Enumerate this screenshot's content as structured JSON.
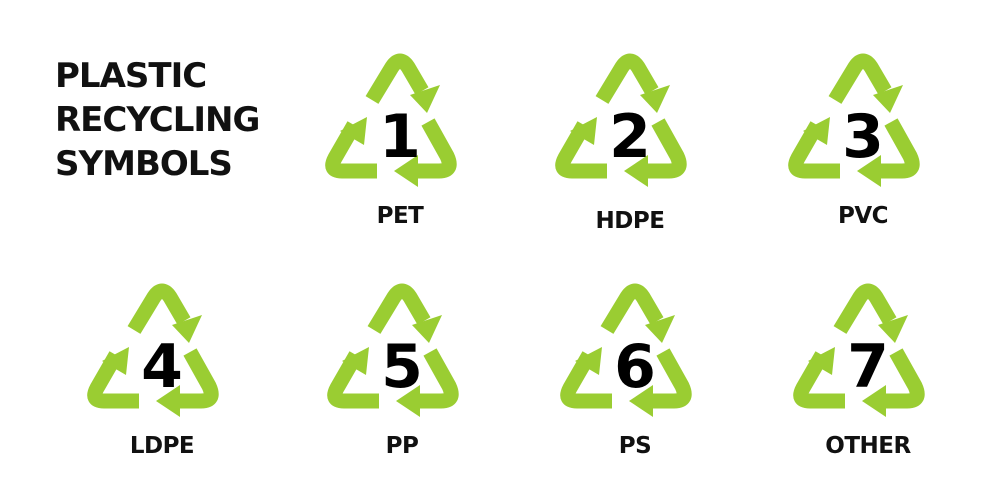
{
  "title": {
    "line1": "PLASTIC",
    "line2": "RECYCLING",
    "line3": "SYMBOLS"
  },
  "colors": {
    "arrow": "#9ACD32",
    "text": "#111111",
    "background": "#FFFFFF"
  },
  "icon": "recycling-triangle-icon",
  "symbols": [
    {
      "number": "1",
      "code": "PET"
    },
    {
      "number": "2",
      "code": "HDPE"
    },
    {
      "number": "3",
      "code": "PVC"
    },
    {
      "number": "4",
      "code": "LDPE"
    },
    {
      "number": "5",
      "code": "PP"
    },
    {
      "number": "6",
      "code": "PS"
    },
    {
      "number": "7",
      "code": "OTHER"
    }
  ]
}
